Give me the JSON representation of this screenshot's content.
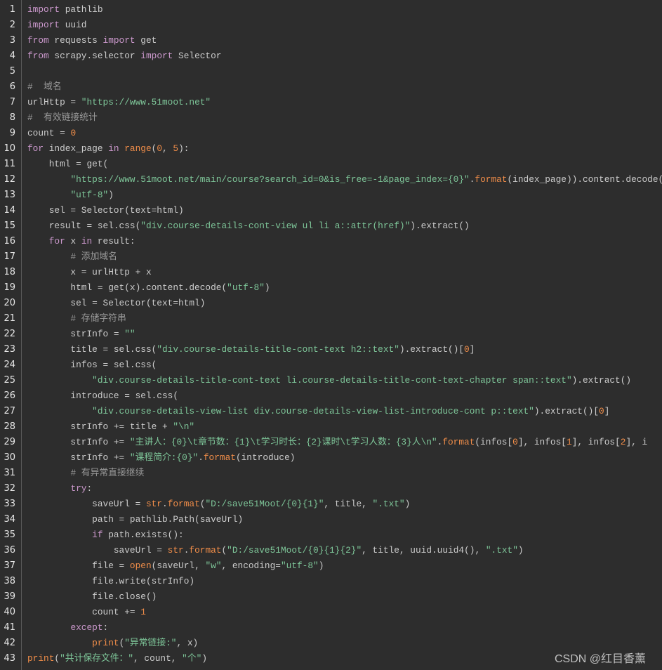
{
  "theme": {
    "background": "#2d2d2d",
    "keyword": "#cc99cd",
    "string": "#7ec699",
    "number": "#f08d49",
    "function": "#f08d49",
    "comment": "#999999",
    "text": "#cccccc"
  },
  "watermark": "CSDN @红目香薰",
  "lines": [
    [
      [
        "k",
        "import"
      ],
      [
        "p",
        " pathlib"
      ]
    ],
    [
      [
        "k",
        "import"
      ],
      [
        "p",
        " uuid"
      ]
    ],
    [
      [
        "k",
        "from"
      ],
      [
        "p",
        " requests "
      ],
      [
        "k",
        "import"
      ],
      [
        "p",
        " get"
      ]
    ],
    [
      [
        "k",
        "from"
      ],
      [
        "p",
        " scrapy.selector "
      ],
      [
        "k",
        "import"
      ],
      [
        "p",
        " Selector"
      ]
    ],
    [],
    [
      [
        "c",
        "#  域名"
      ]
    ],
    [
      [
        "p",
        "urlHttp = "
      ],
      [
        "s",
        "\"https://www.51moot.net\""
      ]
    ],
    [
      [
        "c",
        "#  有效链接统计"
      ]
    ],
    [
      [
        "p",
        "count = "
      ],
      [
        "n",
        "0"
      ]
    ],
    [
      [
        "k",
        "for"
      ],
      [
        "p",
        " index_page "
      ],
      [
        "k",
        "in"
      ],
      [
        "p",
        " "
      ],
      [
        "f",
        "range"
      ],
      [
        "p",
        "("
      ],
      [
        "n",
        "0"
      ],
      [
        "p",
        ", "
      ],
      [
        "n",
        "5"
      ],
      [
        "p",
        "):"
      ]
    ],
    [
      [
        "p",
        "    html = get("
      ]
    ],
    [
      [
        "p",
        "        "
      ],
      [
        "s",
        "\"https://www.51moot.net/main/course?search_id=0&is_free=-1&page_index={0}\""
      ],
      [
        "p",
        "."
      ],
      [
        "f",
        "format"
      ],
      [
        "p",
        "(index_page)).content.decode("
      ]
    ],
    [
      [
        "p",
        "        "
      ],
      [
        "s",
        "\"utf-8\""
      ],
      [
        "p",
        ")"
      ]
    ],
    [
      [
        "p",
        "    sel = Selector(text=html)"
      ]
    ],
    [
      [
        "p",
        "    result = sel.css("
      ],
      [
        "s",
        "\"div.course-details-cont-view ul li a::attr(href)\""
      ],
      [
        "p",
        ").extract()"
      ]
    ],
    [
      [
        "p",
        "    "
      ],
      [
        "k",
        "for"
      ],
      [
        "p",
        " x "
      ],
      [
        "k",
        "in"
      ],
      [
        "p",
        " result:"
      ]
    ],
    [
      [
        "p",
        "        "
      ],
      [
        "c",
        "# 添加域名"
      ]
    ],
    [
      [
        "p",
        "        x = urlHttp + x"
      ]
    ],
    [
      [
        "p",
        "        html = get(x).content.decode("
      ],
      [
        "s",
        "\"utf-8\""
      ],
      [
        "p",
        ")"
      ]
    ],
    [
      [
        "p",
        "        sel = Selector(text=html)"
      ]
    ],
    [
      [
        "p",
        "        "
      ],
      [
        "c",
        "# 存储字符串"
      ]
    ],
    [
      [
        "p",
        "        strInfo = "
      ],
      [
        "s",
        "\"\""
      ]
    ],
    [
      [
        "p",
        "        title = sel.css("
      ],
      [
        "s",
        "\"div.course-details-title-cont-text h2::text\""
      ],
      [
        "p",
        ").extract()["
      ],
      [
        "n",
        "0"
      ],
      [
        "p",
        "]"
      ]
    ],
    [
      [
        "p",
        "        infos = sel.css("
      ]
    ],
    [
      [
        "p",
        "            "
      ],
      [
        "s",
        "\"div.course-details-title-cont-text li.course-details-title-cont-text-chapter span::text\""
      ],
      [
        "p",
        ").extract()"
      ]
    ],
    [
      [
        "p",
        "        introduce = sel.css("
      ]
    ],
    [
      [
        "p",
        "            "
      ],
      [
        "s",
        "\"div.course-details-view-list div.course-details-view-list-introduce-cont p::text\""
      ],
      [
        "p",
        ").extract()["
      ],
      [
        "n",
        "0"
      ],
      [
        "p",
        "]"
      ]
    ],
    [
      [
        "p",
        "        strInfo += title + "
      ],
      [
        "s",
        "\"\\n\""
      ]
    ],
    [
      [
        "p",
        "        strInfo += "
      ],
      [
        "s",
        "\"主讲人：{0}\\t章节数：{1}\\t学习时长：{2}课时\\t学习人数：{3}人\\n\""
      ],
      [
        "p",
        "."
      ],
      [
        "f",
        "format"
      ],
      [
        "p",
        "(infos["
      ],
      [
        "n",
        "0"
      ],
      [
        "p",
        "], infos["
      ],
      [
        "n",
        "1"
      ],
      [
        "p",
        "], infos["
      ],
      [
        "n",
        "2"
      ],
      [
        "p",
        "], i"
      ]
    ],
    [
      [
        "p",
        "        strInfo += "
      ],
      [
        "s",
        "\"课程简介:{0}\""
      ],
      [
        "p",
        "."
      ],
      [
        "f",
        "format"
      ],
      [
        "p",
        "(introduce)"
      ]
    ],
    [
      [
        "p",
        "        "
      ],
      [
        "c",
        "# 有异常直接继续"
      ]
    ],
    [
      [
        "p",
        "        "
      ],
      [
        "k",
        "try"
      ],
      [
        "p",
        ":"
      ]
    ],
    [
      [
        "p",
        "            saveUrl = "
      ],
      [
        "f",
        "str"
      ],
      [
        "p",
        "."
      ],
      [
        "f",
        "format"
      ],
      [
        "p",
        "("
      ],
      [
        "s",
        "\"D:/save51Moot/{0}{1}\""
      ],
      [
        "p",
        ", title, "
      ],
      [
        "s",
        "\".txt\""
      ],
      [
        "p",
        ")"
      ]
    ],
    [
      [
        "p",
        "            path = pathlib.Path(saveUrl)"
      ]
    ],
    [
      [
        "p",
        "            "
      ],
      [
        "k",
        "if"
      ],
      [
        "p",
        " path.exists():"
      ]
    ],
    [
      [
        "p",
        "                saveUrl = "
      ],
      [
        "f",
        "str"
      ],
      [
        "p",
        "."
      ],
      [
        "f",
        "format"
      ],
      [
        "p",
        "("
      ],
      [
        "s",
        "\"D:/save51Moot/{0}{1}{2}\""
      ],
      [
        "p",
        ", title, uuid.uuid4(), "
      ],
      [
        "s",
        "\".txt\""
      ],
      [
        "p",
        ")"
      ]
    ],
    [
      [
        "p",
        "            file = "
      ],
      [
        "f",
        "open"
      ],
      [
        "p",
        "(saveUrl, "
      ],
      [
        "s",
        "\"w\""
      ],
      [
        "p",
        ", encoding="
      ],
      [
        "s",
        "\"utf-8\""
      ],
      [
        "p",
        ")"
      ]
    ],
    [
      [
        "p",
        "            file.write(strInfo)"
      ]
    ],
    [
      [
        "p",
        "            file.close()"
      ]
    ],
    [
      [
        "p",
        "            count += "
      ],
      [
        "n",
        "1"
      ]
    ],
    [
      [
        "p",
        "        "
      ],
      [
        "k",
        "except"
      ],
      [
        "p",
        ":"
      ]
    ],
    [
      [
        "p",
        "            "
      ],
      [
        "f",
        "print"
      ],
      [
        "p",
        "("
      ],
      [
        "s",
        "\"异常链接:\""
      ],
      [
        "p",
        ", x)"
      ]
    ],
    [
      [
        "f",
        "print"
      ],
      [
        "p",
        "("
      ],
      [
        "s",
        "\"共计保存文件：\""
      ],
      [
        "p",
        ", count, "
      ],
      [
        "s",
        "\"个\""
      ],
      [
        "p",
        ")"
      ]
    ]
  ]
}
